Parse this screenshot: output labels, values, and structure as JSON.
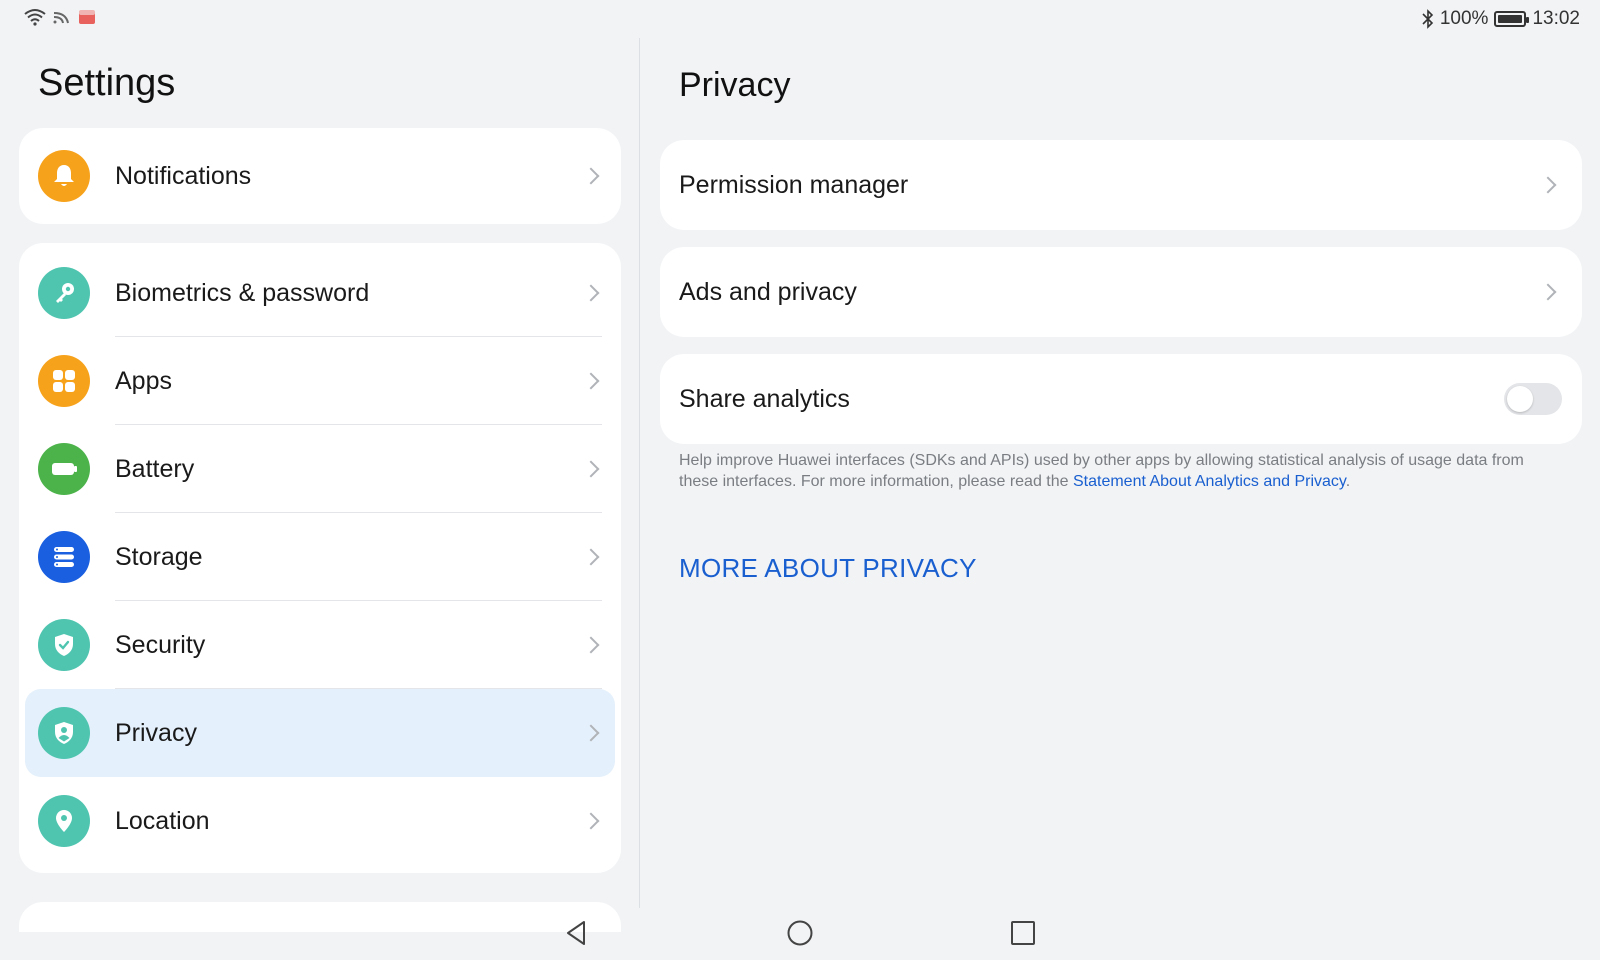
{
  "status_bar": {
    "battery_text": "100%",
    "time": "13:02",
    "icons": [
      "wifi-icon",
      "cast-icon",
      "notification-app-icon",
      "bluetooth-icon",
      "battery-icon"
    ]
  },
  "left_pane": {
    "title": "Settings",
    "top_item": {
      "label": "Notifications",
      "icon": "bell-icon",
      "color": "#f7a21b"
    },
    "items": [
      {
        "label": "Biometrics & password",
        "icon": "key-icon",
        "color": "#4fc5b0"
      },
      {
        "label": "Apps",
        "icon": "apps-grid-icon",
        "color": "#f7a21b"
      },
      {
        "label": "Battery",
        "icon": "battery-icon",
        "color": "#4cb34a"
      },
      {
        "label": "Storage",
        "icon": "storage-icon",
        "color": "#1a5fe0"
      },
      {
        "label": "Security",
        "icon": "shield-check-icon",
        "color": "#4fc5b0"
      },
      {
        "label": "Privacy",
        "icon": "privacy-shield-icon",
        "color": "#4fc5b0",
        "selected": true
      },
      {
        "label": "Location",
        "icon": "location-pin-icon",
        "color": "#4fc5b0"
      }
    ]
  },
  "right_pane": {
    "title": "Privacy",
    "permission_manager": "Permission manager",
    "ads_privacy": "Ads and privacy",
    "share_analytics": {
      "label": "Share analytics",
      "enabled": false
    },
    "description": {
      "text": "Help improve Huawei interfaces (SDKs and APIs) used by other apps by allowing statistical analysis of usage data from these interfaces. For more information, please read the ",
      "link": "Statement About Analytics and Privacy",
      "suffix": "."
    },
    "more_link": "MORE ABOUT PRIVACY"
  },
  "colors": {
    "accent": "#1a5fd0",
    "background": "#f1f3f5",
    "selected": "#e4f0fb"
  }
}
